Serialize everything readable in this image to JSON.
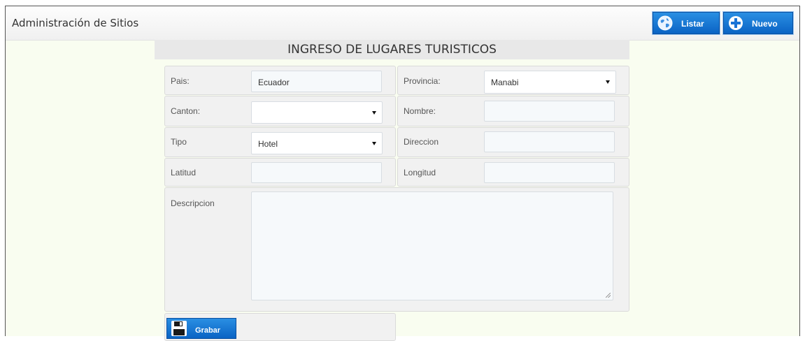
{
  "header": {
    "title": "Administración de Sitios",
    "listar_label": "Listar",
    "nuevo_label": "Nuevo"
  },
  "form": {
    "title": "INGRESO DE LUGARES TURISTICOS",
    "pais": {
      "label": "Pais:",
      "value": "Ecuador"
    },
    "provincia": {
      "label": "Provincia:",
      "value": "Manabi"
    },
    "canton": {
      "label": "Canton:",
      "value": ""
    },
    "nombre": {
      "label": "Nombre:",
      "value": ""
    },
    "tipo": {
      "label": "Tipo",
      "value": "Hotel"
    },
    "direccion": {
      "label": "Direccion",
      "value": ""
    },
    "latitud": {
      "label": "Latitud",
      "value": ""
    },
    "longitud": {
      "label": "Longitud",
      "value": ""
    },
    "descripcion": {
      "label": "Descripcion",
      "value": ""
    },
    "save_label": "Grabar"
  },
  "colors": {
    "button_blue": "#0a63c4",
    "page_background": "#f9fdf0"
  },
  "icons": {
    "listar": "globe-icon",
    "nuevo": "plus-icon",
    "grabar": "floppy-disk-icon"
  }
}
